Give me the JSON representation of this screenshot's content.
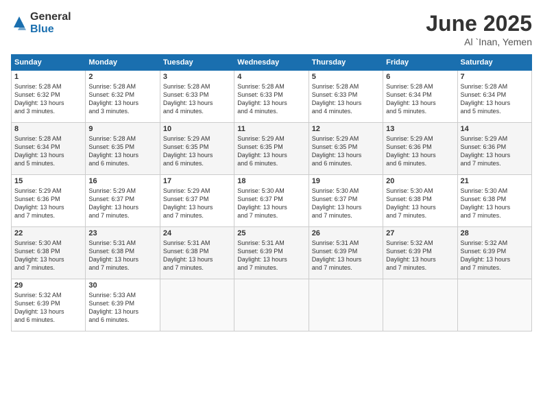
{
  "logo": {
    "general": "General",
    "blue": "Blue"
  },
  "title": "June 2025",
  "subtitle": "Al `Inan, Yemen",
  "days_header": [
    "Sunday",
    "Monday",
    "Tuesday",
    "Wednesday",
    "Thursday",
    "Friday",
    "Saturday"
  ],
  "weeks": [
    [
      {
        "day": "1",
        "info": "Sunrise: 5:28 AM\nSunset: 6:32 PM\nDaylight: 13 hours\nand 3 minutes."
      },
      {
        "day": "2",
        "info": "Sunrise: 5:28 AM\nSunset: 6:32 PM\nDaylight: 13 hours\nand 3 minutes."
      },
      {
        "day": "3",
        "info": "Sunrise: 5:28 AM\nSunset: 6:33 PM\nDaylight: 13 hours\nand 4 minutes."
      },
      {
        "day": "4",
        "info": "Sunrise: 5:28 AM\nSunset: 6:33 PM\nDaylight: 13 hours\nand 4 minutes."
      },
      {
        "day": "5",
        "info": "Sunrise: 5:28 AM\nSunset: 6:33 PM\nDaylight: 13 hours\nand 4 minutes."
      },
      {
        "day": "6",
        "info": "Sunrise: 5:28 AM\nSunset: 6:34 PM\nDaylight: 13 hours\nand 5 minutes."
      },
      {
        "day": "7",
        "info": "Sunrise: 5:28 AM\nSunset: 6:34 PM\nDaylight: 13 hours\nand 5 minutes."
      }
    ],
    [
      {
        "day": "8",
        "info": "Sunrise: 5:28 AM\nSunset: 6:34 PM\nDaylight: 13 hours\nand 5 minutes."
      },
      {
        "day": "9",
        "info": "Sunrise: 5:28 AM\nSunset: 6:35 PM\nDaylight: 13 hours\nand 6 minutes."
      },
      {
        "day": "10",
        "info": "Sunrise: 5:29 AM\nSunset: 6:35 PM\nDaylight: 13 hours\nand 6 minutes."
      },
      {
        "day": "11",
        "info": "Sunrise: 5:29 AM\nSunset: 6:35 PM\nDaylight: 13 hours\nand 6 minutes."
      },
      {
        "day": "12",
        "info": "Sunrise: 5:29 AM\nSunset: 6:35 PM\nDaylight: 13 hours\nand 6 minutes."
      },
      {
        "day": "13",
        "info": "Sunrise: 5:29 AM\nSunset: 6:36 PM\nDaylight: 13 hours\nand 6 minutes."
      },
      {
        "day": "14",
        "info": "Sunrise: 5:29 AM\nSunset: 6:36 PM\nDaylight: 13 hours\nand 7 minutes."
      }
    ],
    [
      {
        "day": "15",
        "info": "Sunrise: 5:29 AM\nSunset: 6:36 PM\nDaylight: 13 hours\nand 7 minutes."
      },
      {
        "day": "16",
        "info": "Sunrise: 5:29 AM\nSunset: 6:37 PM\nDaylight: 13 hours\nand 7 minutes."
      },
      {
        "day": "17",
        "info": "Sunrise: 5:29 AM\nSunset: 6:37 PM\nDaylight: 13 hours\nand 7 minutes."
      },
      {
        "day": "18",
        "info": "Sunrise: 5:30 AM\nSunset: 6:37 PM\nDaylight: 13 hours\nand 7 minutes."
      },
      {
        "day": "19",
        "info": "Sunrise: 5:30 AM\nSunset: 6:37 PM\nDaylight: 13 hours\nand 7 minutes."
      },
      {
        "day": "20",
        "info": "Sunrise: 5:30 AM\nSunset: 6:38 PM\nDaylight: 13 hours\nand 7 minutes."
      },
      {
        "day": "21",
        "info": "Sunrise: 5:30 AM\nSunset: 6:38 PM\nDaylight: 13 hours\nand 7 minutes."
      }
    ],
    [
      {
        "day": "22",
        "info": "Sunrise: 5:30 AM\nSunset: 6:38 PM\nDaylight: 13 hours\nand 7 minutes."
      },
      {
        "day": "23",
        "info": "Sunrise: 5:31 AM\nSunset: 6:38 PM\nDaylight: 13 hours\nand 7 minutes."
      },
      {
        "day": "24",
        "info": "Sunrise: 5:31 AM\nSunset: 6:38 PM\nDaylight: 13 hours\nand 7 minutes."
      },
      {
        "day": "25",
        "info": "Sunrise: 5:31 AM\nSunset: 6:39 PM\nDaylight: 13 hours\nand 7 minutes."
      },
      {
        "day": "26",
        "info": "Sunrise: 5:31 AM\nSunset: 6:39 PM\nDaylight: 13 hours\nand 7 minutes."
      },
      {
        "day": "27",
        "info": "Sunrise: 5:32 AM\nSunset: 6:39 PM\nDaylight: 13 hours\nand 7 minutes."
      },
      {
        "day": "28",
        "info": "Sunrise: 5:32 AM\nSunset: 6:39 PM\nDaylight: 13 hours\nand 7 minutes."
      }
    ],
    [
      {
        "day": "29",
        "info": "Sunrise: 5:32 AM\nSunset: 6:39 PM\nDaylight: 13 hours\nand 6 minutes."
      },
      {
        "day": "30",
        "info": "Sunrise: 5:33 AM\nSunset: 6:39 PM\nDaylight: 13 hours\nand 6 minutes."
      },
      {
        "day": "",
        "info": ""
      },
      {
        "day": "",
        "info": ""
      },
      {
        "day": "",
        "info": ""
      },
      {
        "day": "",
        "info": ""
      },
      {
        "day": "",
        "info": ""
      }
    ]
  ]
}
